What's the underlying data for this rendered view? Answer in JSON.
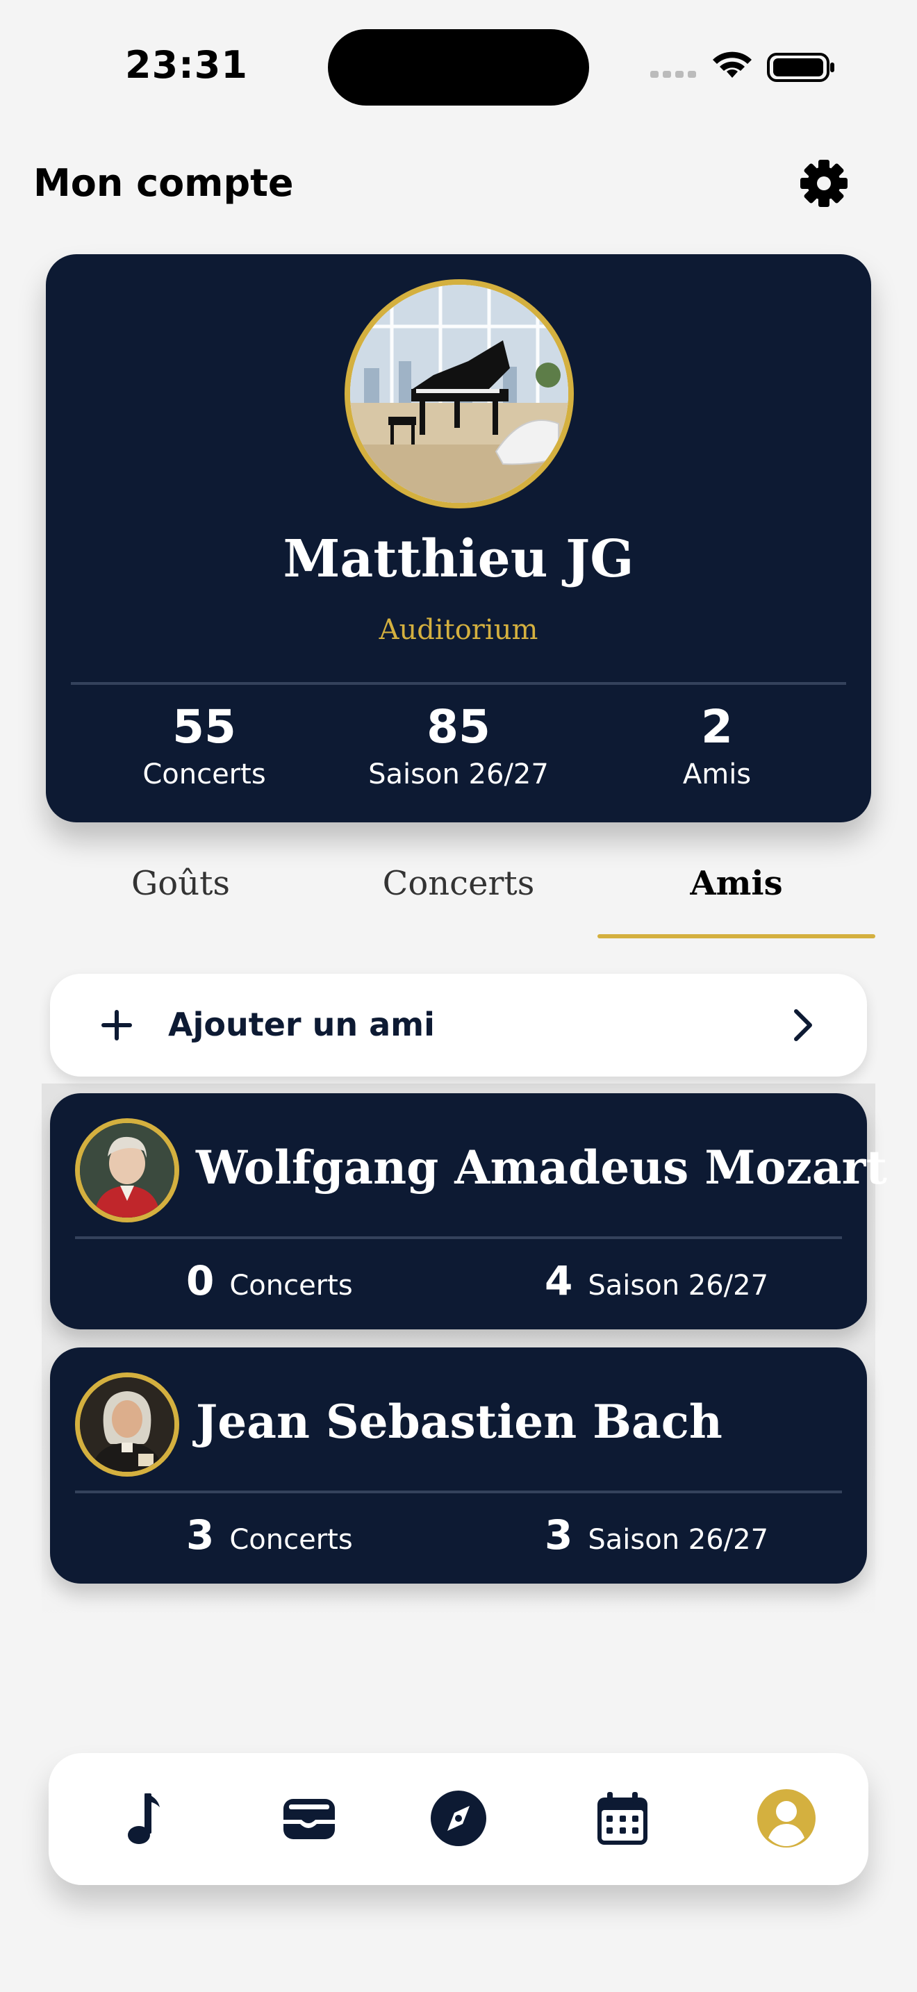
{
  "status_bar": {
    "time": "23:31"
  },
  "header": {
    "title": "Mon compte"
  },
  "profile": {
    "name": "Matthieu JG",
    "level": "Auditorium",
    "stats": [
      {
        "value": "55",
        "label": "Concerts"
      },
      {
        "value": "85",
        "label": "Saison 26/27"
      },
      {
        "value": "2",
        "label": "Amis"
      }
    ]
  },
  "tabs": [
    {
      "label": "Goûts",
      "active": false
    },
    {
      "label": "Concerts",
      "active": false
    },
    {
      "label": "Amis",
      "active": true
    }
  ],
  "add_friend": {
    "label": "Ajouter un ami"
  },
  "friends": [
    {
      "name": "Wolfgang Amadeus Mozart",
      "concerts": "0",
      "concerts_label": "Concerts",
      "season": "4",
      "season_label": "Saison 26/27"
    },
    {
      "name": "Jean Sebastien Bach",
      "concerts": "3",
      "concerts_label": "Concerts",
      "season": "3",
      "season_label": "Saison 26/27"
    }
  ],
  "bottom_nav": [
    {
      "icon": "music-note-icon",
      "active": false
    },
    {
      "icon": "wallet-icon",
      "active": false
    },
    {
      "icon": "compass-icon",
      "active": false
    },
    {
      "icon": "calendar-icon",
      "active": false
    },
    {
      "icon": "profile-icon",
      "active": true
    }
  ],
  "colors": {
    "navy": "#0d1a33",
    "gold": "#d4b03f",
    "background": "#f4f4f4"
  }
}
